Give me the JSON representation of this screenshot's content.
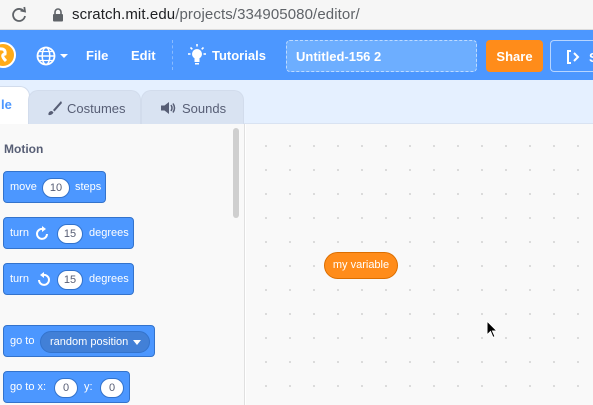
{
  "browser": {
    "url_host": "scratch.mit.edu",
    "url_path": "/projects/334905080/editor/"
  },
  "menu": {
    "file_label": "File",
    "edit_label": "Edit",
    "tutorials_label": "Tutorials",
    "project_title": "Untitled-156 2",
    "share_label": "Share",
    "see_label": "S"
  },
  "tabs": [
    {
      "label": "le",
      "active": true
    },
    {
      "label": "Costumes",
      "icon": "brush-icon"
    },
    {
      "label": "Sounds",
      "icon": "speaker-icon"
    }
  ],
  "palette": {
    "category_title": "Motion",
    "blocks": [
      {
        "parts": [
          "move",
          "10",
          "steps"
        ]
      },
      {
        "parts": [
          "turn",
          "15",
          "degrees"
        ],
        "icon": "rotate-clockwise-icon"
      },
      {
        "parts": [
          "turn",
          "15",
          "degrees"
        ],
        "icon": "rotate-counterclockwise-icon"
      },
      {
        "parts": [
          "go to",
          "random position"
        ]
      },
      {
        "parts": [
          "go to x:",
          "0",
          "y:",
          "0"
        ]
      }
    ]
  },
  "workspace": {
    "variable_label": "my variable"
  },
  "colors": {
    "menu_blue": "#4c97ff",
    "share_orange": "#ff8c1a",
    "motion_block": "#4c97ff",
    "variable_orange": "#ff8c1a",
    "tab_strip": "#e5f0ff"
  }
}
